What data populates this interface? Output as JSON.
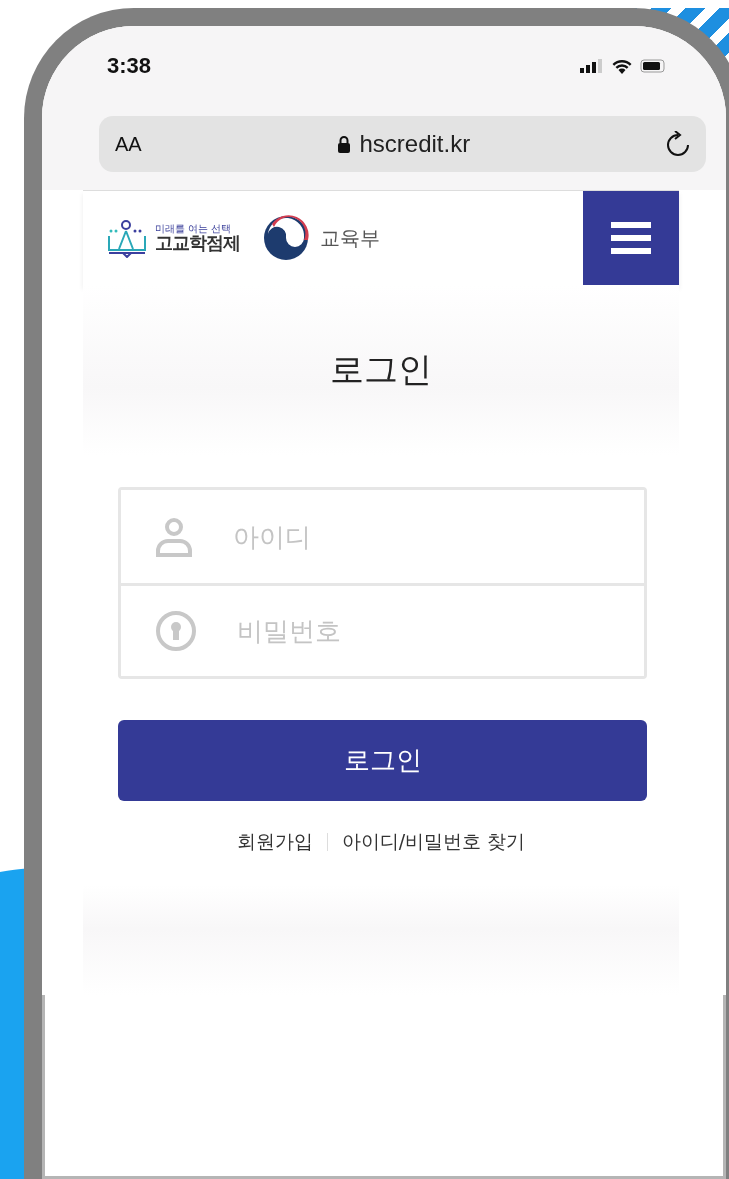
{
  "status_bar": {
    "time": "3:38"
  },
  "browser": {
    "text_size_button": "AA",
    "url": "hscredit.kr"
  },
  "header": {
    "logo_tagline": "미래를 여는 선택",
    "logo_title": "고교학점제",
    "ministry": "교육부"
  },
  "login": {
    "title": "로그인",
    "fields": [
      {
        "kind": "user",
        "placeholder": "아이디"
      },
      {
        "kind": "password",
        "placeholder": "비밀번호"
      }
    ],
    "submit": "로그인",
    "links": [
      "회원가입",
      "아이디/비밀번호 찾기"
    ]
  }
}
